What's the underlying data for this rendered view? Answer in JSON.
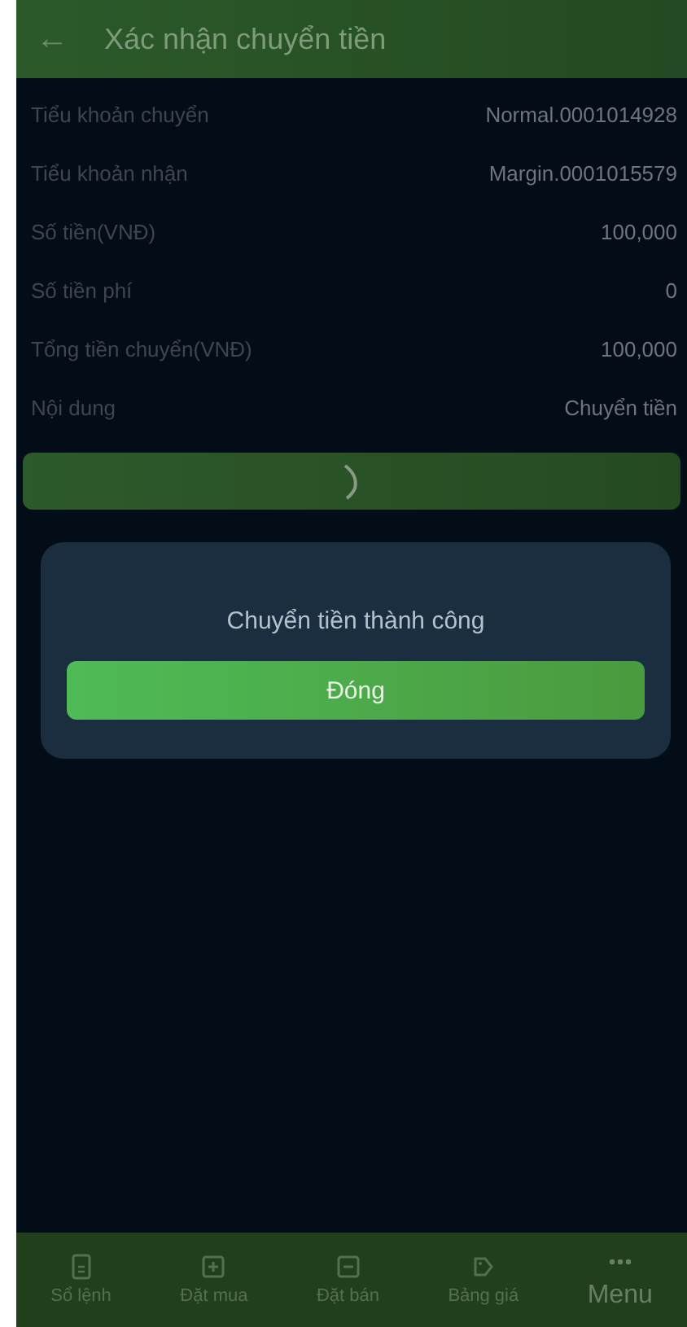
{
  "header": {
    "back": "←",
    "title": "Xác nhận chuyển tiền"
  },
  "details": [
    {
      "label": "Tiểu khoản chuyển",
      "value": "Normal.0001014928"
    },
    {
      "label": "Tiểu khoản nhận",
      "value": "Margin.0001015579"
    },
    {
      "label": "Số tiền(VNĐ)",
      "value": "100,000"
    },
    {
      "label": "Số tiền phí",
      "value": "0"
    },
    {
      "label": "Tổng tiền chuyển(VNĐ)",
      "value": "100,000"
    },
    {
      "label": "Nội dung",
      "value": "Chuyển tiền"
    }
  ],
  "dialog": {
    "message": "Chuyển tiền thành công",
    "button": "Đóng"
  },
  "nav": [
    {
      "kind": "orders",
      "label": "Sổ lệnh"
    },
    {
      "kind": "buy",
      "label": "Đặt mua"
    },
    {
      "kind": "sell",
      "label": "Đặt bán"
    },
    {
      "kind": "tag",
      "label": "Bảng giá"
    },
    {
      "kind": "more",
      "label": "Menu"
    }
  ]
}
